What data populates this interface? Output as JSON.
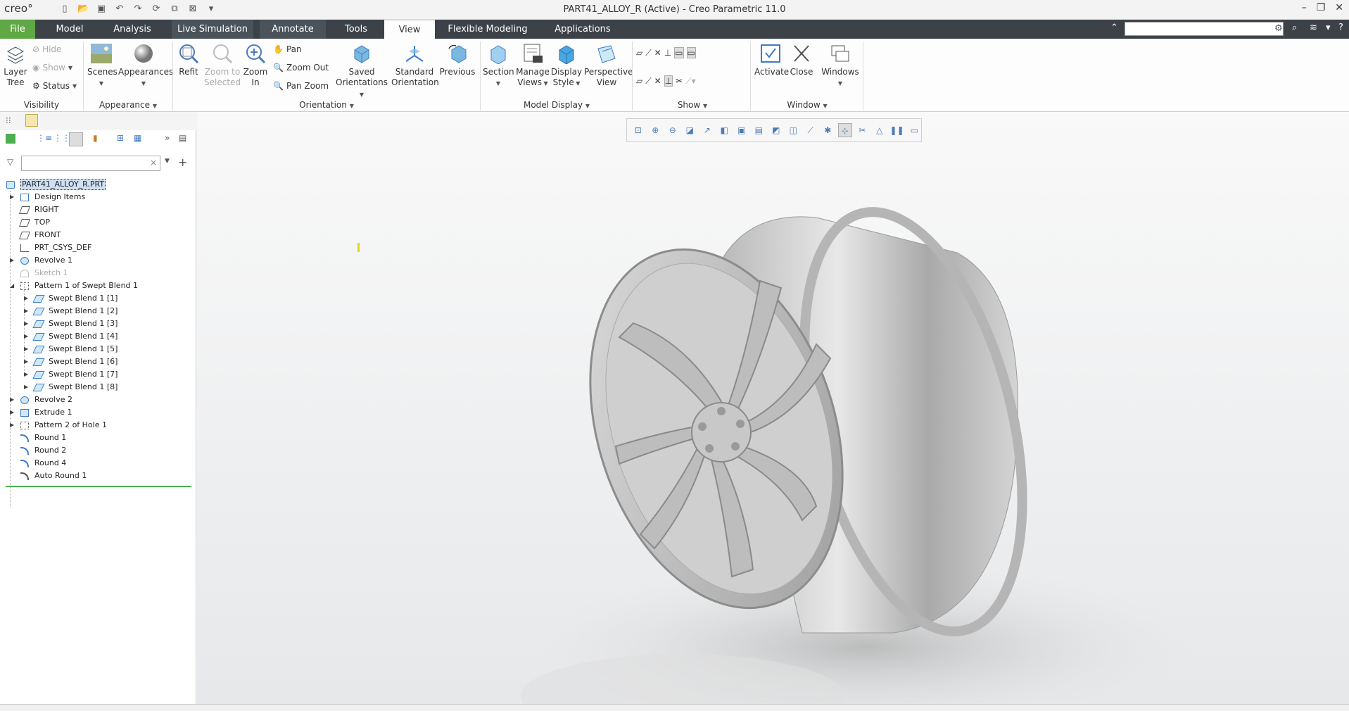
{
  "window": {
    "app_name": "creo°",
    "title": "PART41_ALLOY_R (Active) - Creo Parametric 11.0"
  },
  "tabs": [
    {
      "label": "File"
    },
    {
      "label": "Model"
    },
    {
      "label": "Analysis"
    },
    {
      "label": "Live Simulation"
    },
    {
      "label": "Annotate"
    },
    {
      "label": "Tools"
    },
    {
      "label": "View"
    },
    {
      "label": "Flexible Modeling"
    },
    {
      "label": "Applications"
    }
  ],
  "ribbon": {
    "visibility": {
      "layer_tree": "Layer\nTree",
      "hide": "Hide",
      "show": "Show",
      "status": "Status",
      "group": "Visibility"
    },
    "appearance": {
      "scenes": "Scenes",
      "appearances": "Appearances",
      "group": "Appearance"
    },
    "orientation": {
      "refit": "Refit",
      "zoom_to_selected": "Zoom to\nSelected",
      "zoom_in": "Zoom\nIn",
      "pan": "Pan",
      "zoom_out": "Zoom Out",
      "pan_zoom": "Pan Zoom",
      "saved_orientations": "Saved\nOrientations",
      "standard_orientation": "Standard\nOrientation",
      "previous": "Previous",
      "group": "Orientation"
    },
    "model_display": {
      "section": "Section",
      "manage_views": "Manage\nViews",
      "display_style": "Display\nStyle",
      "perspective_view": "Perspective\nView",
      "group": "Model Display"
    },
    "show": {
      "group": "Show"
    },
    "window": {
      "activate": "Activate",
      "close": "Close",
      "windows": "Windows",
      "group": "Window"
    }
  },
  "model_tree": {
    "root": "PART41_ALLOY_R.PRT",
    "items": [
      {
        "label": "Design Items"
      },
      {
        "label": "RIGHT"
      },
      {
        "label": "TOP"
      },
      {
        "label": "FRONT"
      },
      {
        "label": "PRT_CSYS_DEF"
      },
      {
        "label": "Revolve 1"
      },
      {
        "label": "Sketch 1"
      },
      {
        "label": "Pattern 1 of Swept Blend 1"
      },
      {
        "label": "Swept Blend 1 [1]"
      },
      {
        "label": "Swept Blend 1 [2]"
      },
      {
        "label": "Swept Blend 1 [3]"
      },
      {
        "label": "Swept Blend 1 [4]"
      },
      {
        "label": "Swept Blend 1 [5]"
      },
      {
        "label": "Swept Blend 1 [6]"
      },
      {
        "label": "Swept Blend 1 [7]"
      },
      {
        "label": "Swept Blend 1 [8]"
      },
      {
        "label": "Revolve 2"
      },
      {
        "label": "Extrude 1"
      },
      {
        "label": "Pattern 2 of Hole 1"
      },
      {
        "label": "Round 1"
      },
      {
        "label": "Round 2"
      },
      {
        "label": "Round 4"
      },
      {
        "label": "Auto Round 1"
      }
    ]
  },
  "colors": {
    "file_tab": "#5fa845",
    "tab_bar": "#3c4248",
    "accent_blue": "#3d7bc8"
  }
}
